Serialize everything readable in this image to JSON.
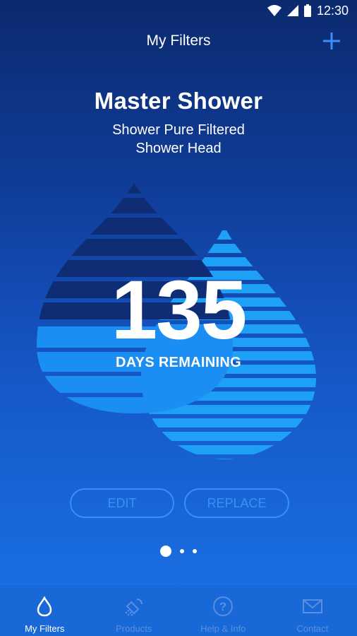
{
  "status_bar": {
    "time": "12:30"
  },
  "app_bar": {
    "title": "My Filters"
  },
  "filter": {
    "name": "Master Shower",
    "product_line1": "Shower Pure Filtered",
    "product_line2": "Shower Head",
    "days_remaining": "135",
    "days_label": "DAYS REMAINING"
  },
  "actions": {
    "edit_label": "EDIT",
    "replace_label": "REPLACE"
  },
  "pager": {
    "pages": 3,
    "current": 1
  },
  "bottom_nav": [
    {
      "label": "My Filters",
      "icon": "drop-icon",
      "active": true
    },
    {
      "label": "Products",
      "icon": "showerhead-icon",
      "active": false
    },
    {
      "label": "Help & Info",
      "icon": "question-icon",
      "active": false
    },
    {
      "label": "Contact",
      "icon": "mail-icon",
      "active": false
    }
  ],
  "colors": {
    "accent": "#3b8ff5",
    "background_top": "#0b2a6e",
    "background_bottom": "#1a73e8",
    "nav_bg": "#1868d8",
    "nav_inactive": "#5a8fdf"
  }
}
